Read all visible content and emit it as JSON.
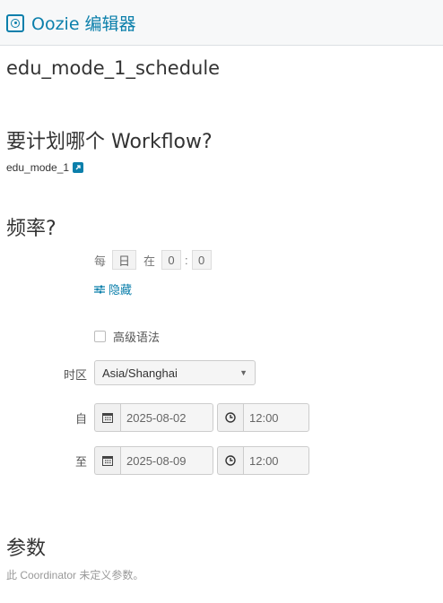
{
  "header": {
    "app_title": "Oozie 编辑器",
    "icon": "oozie-target-icon",
    "accent_color": "#0b7fab"
  },
  "coordinator": {
    "name": "edu_mode_1_schedule"
  },
  "workflow": {
    "question": "要计划哪个 Workflow?",
    "selected": "edu_mode_1",
    "link_icon": "external-link-icon"
  },
  "frequency": {
    "question": "频率?",
    "every_label": "每",
    "unit_value": "日",
    "at_label": "在",
    "hour_value": "0",
    "separator": ":",
    "minute_value": "0",
    "hide_link": "隐藏",
    "advanced_syntax_label": "高级语法",
    "advanced_syntax_checked": false
  },
  "timezone": {
    "label": "时区",
    "value": "Asia/Shanghai"
  },
  "start": {
    "label": "自",
    "date": "2025-08-02",
    "time": "12:00"
  },
  "end": {
    "label": "至",
    "date": "2025-08-09",
    "time": "12:00"
  },
  "parameters": {
    "title": "参数",
    "empty_message": "此 Coordinator 未定义参数。"
  }
}
